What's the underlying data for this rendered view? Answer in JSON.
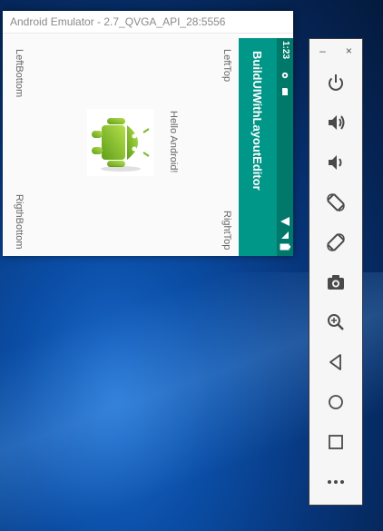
{
  "emulator": {
    "title": "Android Emulator - 2.7_QVGA_API_28:5556"
  },
  "app": {
    "title": "BuildUIWithLayoutEditor",
    "labels": {
      "left_bottom": "LeftBottom",
      "left_top": "LeftTop",
      "hello": "Hello Android!",
      "rigth_bottom": "RigthBottom",
      "right_top": "RightTop"
    },
    "image_icon": "android-robot-icon"
  },
  "status_bar": {
    "time": "1:23"
  },
  "side_panel": {
    "minimize": "–",
    "close": "×",
    "controls": [
      "power-icon",
      "volume-up-icon",
      "volume-down-icon",
      "rotate-left-icon",
      "rotate-right-icon",
      "camera-icon",
      "zoom-icon",
      "back-icon",
      "home-icon",
      "overview-icon",
      "more-icon"
    ]
  },
  "colors": {
    "toolbar": "#009688",
    "status_bar": "#00796b",
    "app_background": "#fafafa",
    "desktop": "#0b4fa8"
  }
}
